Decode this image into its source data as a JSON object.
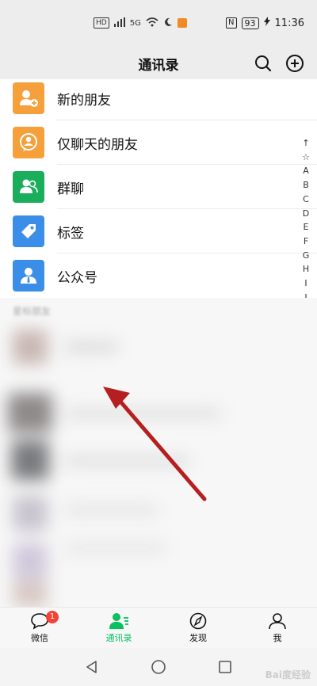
{
  "status_bar": {
    "left_text": "HD",
    "signal_text": "5G",
    "nfc": "N",
    "battery": "93",
    "time": "11:36"
  },
  "header": {
    "title": "通讯录"
  },
  "menu": [
    {
      "label": "新的朋友",
      "icon": "add-friend-icon",
      "color": "#f5a03b"
    },
    {
      "label": "仅聊天的朋友",
      "icon": "chat-only-friend-icon",
      "color": "#f5a03b"
    },
    {
      "label": "群聊",
      "icon": "group-chat-icon",
      "color": "#1aad5b"
    },
    {
      "label": "标签",
      "icon": "tag-icon",
      "color": "#3b8ee8"
    },
    {
      "label": "公众号",
      "icon": "official-account-icon",
      "color": "#3b8ee8"
    }
  ],
  "index_bar": [
    "↑",
    "☆",
    "A",
    "B",
    "C",
    "D",
    "E",
    "F",
    "G",
    "H",
    "I",
    "J"
  ],
  "blurred_section": {
    "label": "星标朋友"
  },
  "tabs": [
    {
      "label": "微信",
      "icon": "chat-icon",
      "badge": "1",
      "active": false
    },
    {
      "label": "通讯录",
      "icon": "contacts-icon",
      "active": true
    },
    {
      "label": "发现",
      "icon": "compass-icon",
      "active": false
    },
    {
      "label": "我",
      "icon": "profile-icon",
      "active": false
    }
  ],
  "watermark": "Bai度经验",
  "colors": {
    "accent": "#07c160",
    "arrow": "#b51f1f"
  }
}
